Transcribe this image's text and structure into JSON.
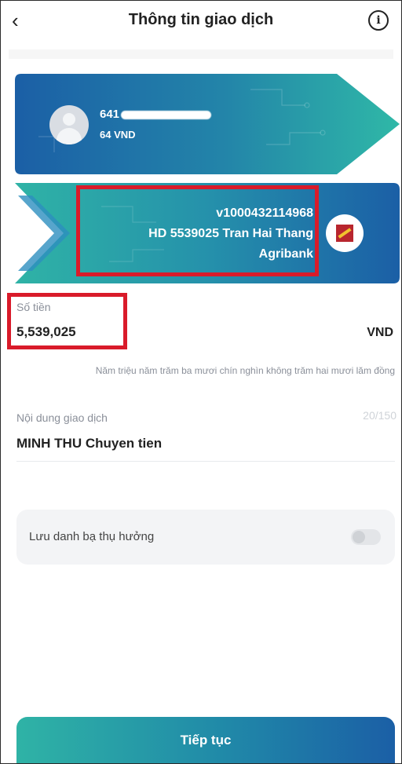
{
  "header": {
    "back_icon": "chevron-left-icon",
    "back_glyph": "‹",
    "title": "Thông tin giao dịch",
    "info_icon": "info-icon",
    "info_glyph": "i"
  },
  "source_account": {
    "account_visible": "641",
    "balance": "64 VND"
  },
  "destination": {
    "account_number": "v1000432114968",
    "recipient": "HD 5539025 Tran Hai Thang",
    "bank": "Agribank"
  },
  "amount": {
    "label": "Số tiền",
    "value": "5,539,025",
    "currency": "VND",
    "in_words": "Năm triệu năm trăm ba mươi chín nghìn không trăm hai mươi lăm đồng"
  },
  "description": {
    "label": "Nội dung giao dịch",
    "counter": "20/150",
    "value": "MINH THU Chuyen tien"
  },
  "save_contact": {
    "label": "Lưu danh bạ thụ hưởng",
    "enabled": false
  },
  "continue_button": {
    "label": "Tiếp tục"
  },
  "colors": {
    "card_teal": "#2fb3a6",
    "card_blue": "#1b5fa6",
    "highlight_red": "#d91b2a"
  }
}
